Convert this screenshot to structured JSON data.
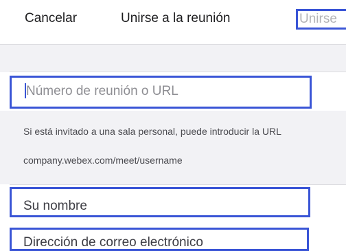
{
  "nav": {
    "cancel_label": "Cancelar",
    "title": "Unirse a la reunión",
    "join_label": "Unirse"
  },
  "form": {
    "meeting_placeholder": "Número de reunión o URL",
    "hint_line1": "Si está invitado a una sala personal, puede introducir la URL",
    "hint_line2": "company.webex.com/meet/username",
    "name_placeholder": "Su nombre",
    "email_placeholder": "Dirección de correo electrónico"
  },
  "colors": {
    "highlight": "#3a55d6",
    "disabled_text": "#b3b3b6",
    "background_band": "#f2f2f5"
  }
}
